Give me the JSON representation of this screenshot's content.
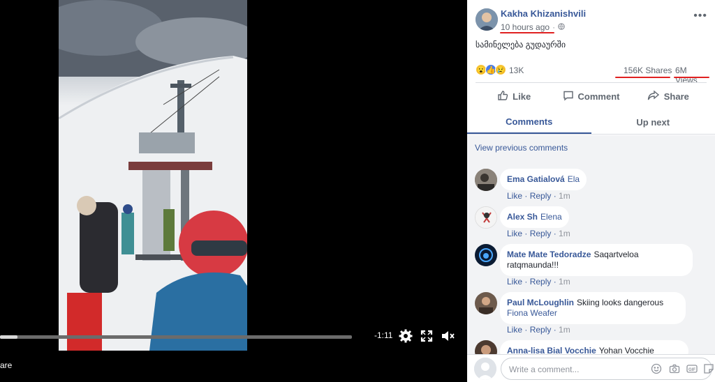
{
  "video": {
    "time_remaining": "-1:11",
    "progress_fraction": 0.05,
    "share_label": "are"
  },
  "post": {
    "author": "Kakha Khizanishvili",
    "time": "10 hours ago",
    "text": "სამინელება გუდაურში",
    "reaction_count": "13K",
    "shares": "156K Shares",
    "views": "6M Views"
  },
  "actions": {
    "like": "Like",
    "comment": "Comment",
    "share": "Share"
  },
  "tabs": {
    "comments": "Comments",
    "up_next": "Up next"
  },
  "comments": {
    "view_previous": "View previous comments",
    "like_label": "Like",
    "reply_label": "Reply",
    "items": [
      {
        "name": "Ema Gatialová",
        "text": "",
        "tag": "Ela",
        "time": "1m"
      },
      {
        "name": "Alex Sh",
        "text": "",
        "tag": "Elena",
        "time": "1m"
      },
      {
        "name": "Mate Mate Tedoradze",
        "text": "Saqartveloa ratqmaunda!!!",
        "tag": "",
        "time": "1m"
      },
      {
        "name": "Paul McLoughlin",
        "text": "Skiing looks dangerous",
        "tag": "Fiona Weafer",
        "time": "1m"
      },
      {
        "name": "Anna-lisa Bial Vocchie",
        "text": "Yohan Vocchie",
        "tag": "",
        "time": ""
      }
    ]
  },
  "composer": {
    "placeholder": "Write a comment..."
  },
  "colors": {
    "link": "#385898",
    "annotation": "#e02020"
  }
}
